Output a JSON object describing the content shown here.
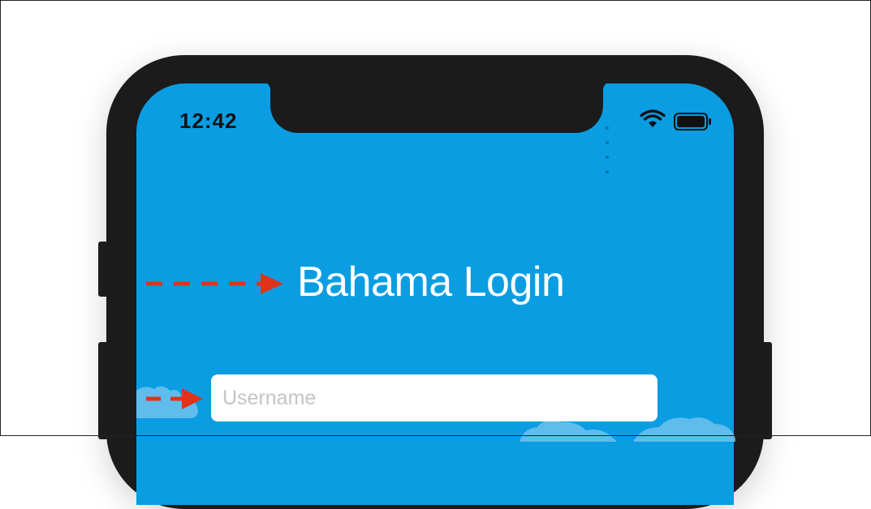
{
  "status_bar": {
    "time": "12:42",
    "icons": [
      "signal-dots-icon",
      "wifi-icon",
      "battery-icon"
    ]
  },
  "login": {
    "title": "Bahama Login",
    "username": {
      "placeholder": "Username",
      "value": ""
    }
  },
  "annotations": {
    "arrow_color": "#e0331a",
    "arrows": [
      "title-pointer-arrow",
      "username-pointer-arrow"
    ]
  },
  "colors": {
    "screen_background": "#0a9de2",
    "phone_frame": "#1b1b1b",
    "title_text": "#ffffff",
    "input_background": "#ffffff"
  }
}
